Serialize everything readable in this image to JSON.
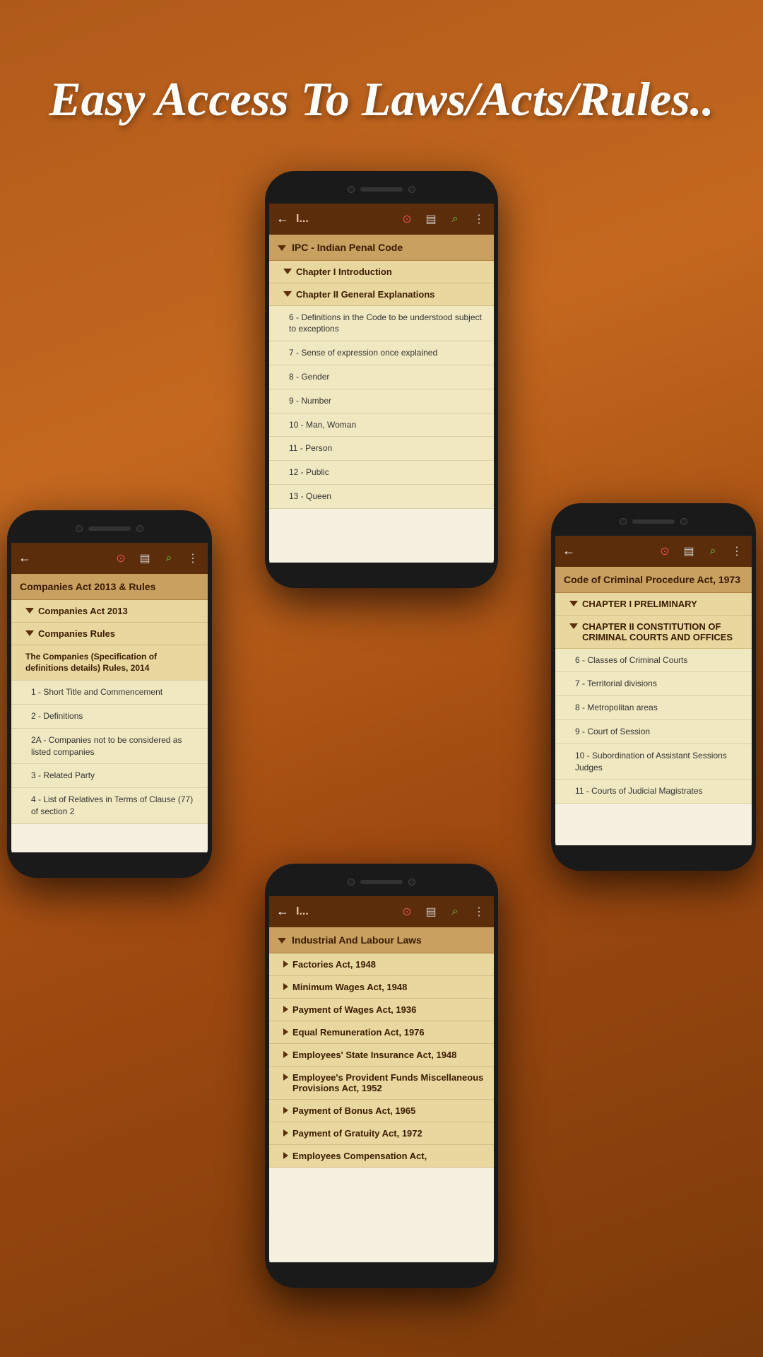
{
  "hero": {
    "title": "Easy Access To Laws/Acts/Rules.."
  },
  "phones": {
    "center": {
      "toolbar": {
        "back": "←",
        "title": "I...",
        "alert_icon": "⊙",
        "doc_icon": "▤",
        "search_icon": "⌕",
        "more_icon": "⋮"
      },
      "content": {
        "header": "IPC - Indian Penal Code",
        "items": [
          {
            "type": "sub-header",
            "text": "Chapter I   Introduction"
          },
          {
            "type": "sub-header",
            "text": "Chapter II   General Explanations"
          },
          {
            "type": "section",
            "text": "6 - Definitions in the Code to be understood subject to exceptions"
          },
          {
            "type": "section",
            "text": "7 - Sense of expression once explained"
          },
          {
            "type": "section",
            "text": "8 - Gender"
          },
          {
            "type": "section",
            "text": "9 - Number"
          },
          {
            "type": "section",
            "text": "10 - Man, Woman"
          },
          {
            "type": "section",
            "text": "11 - Person"
          },
          {
            "type": "section",
            "text": "12 - Public"
          },
          {
            "type": "section",
            "text": "13 - Queen"
          }
        ]
      }
    },
    "left": {
      "toolbar": {
        "back": "←",
        "alert_icon": "⊙",
        "doc_icon": "▤",
        "search_icon": "⌕",
        "more_icon": "⋮"
      },
      "content": {
        "header": "Companies Act 2013 & Rules",
        "items": [
          {
            "type": "sub-header",
            "text": "Companies Act 2013"
          },
          {
            "type": "sub-header",
            "text": "Companies Rules"
          },
          {
            "type": "section2",
            "text": "The Companies (Specification of definitions details) Rules, 2014"
          },
          {
            "type": "section3",
            "text": "1 - Short Title and Commencement"
          },
          {
            "type": "section3",
            "text": "2 - Definitions"
          },
          {
            "type": "section3",
            "text": "2A - Companies not to be considered as listed companies"
          },
          {
            "type": "section3",
            "text": "3 - Related Party"
          },
          {
            "type": "section3",
            "text": "4 - List of Relatives in Terms of Clause (77) of section 2"
          }
        ]
      }
    },
    "right": {
      "toolbar": {
        "back": "←",
        "alert_icon": "⊙",
        "doc_icon": "▤",
        "search_icon": "⌕",
        "more_icon": "⋮"
      },
      "content": {
        "header": "Code of Criminal Procedure Act, 1973",
        "items": [
          {
            "type": "sub-header",
            "text": "CHAPTER I   PRELIMINARY"
          },
          {
            "type": "sub-header",
            "text": "CHAPTER II   CONSTITUTION OF CRIMINAL COURTS AND OFFICES"
          },
          {
            "type": "section",
            "text": "6 - Classes of Criminal Courts"
          },
          {
            "type": "section",
            "text": "7 - Territorial divisions"
          },
          {
            "type": "section",
            "text": "8 - Metropolitan areas"
          },
          {
            "type": "section",
            "text": "9 - Court of Session"
          },
          {
            "type": "section",
            "text": "10 - Subordination of Assistant Sessions Judges"
          },
          {
            "type": "section",
            "text": "11 - Courts of Judicial Magistrates"
          }
        ]
      }
    },
    "bottom": {
      "toolbar": {
        "back": "←",
        "title": "I...",
        "alert_icon": "⊙",
        "doc_icon": "▤",
        "search_icon": "⌕",
        "more_icon": "⋮"
      },
      "content": {
        "header": "Industrial And Labour Laws",
        "items": [
          {
            "type": "sub-header",
            "text": "Factories Act, 1948"
          },
          {
            "type": "sub-header",
            "text": "Minimum Wages Act, 1948"
          },
          {
            "type": "sub-header",
            "text": "Payment of Wages Act, 1936"
          },
          {
            "type": "sub-header",
            "text": "Equal Remuneration Act, 1976"
          },
          {
            "type": "sub-header",
            "text": "Employees' State Insurance Act, 1948"
          },
          {
            "type": "sub-header",
            "text": "Employee's Provident Funds Miscellaneous Provisions Act, 1952"
          },
          {
            "type": "sub-header",
            "text": "Payment of Bonus Act, 1965"
          },
          {
            "type": "sub-header",
            "text": "Payment of Gratuity Act, 1972"
          },
          {
            "type": "sub-header",
            "text": "Employees Compensation Act,"
          }
        ]
      }
    }
  }
}
